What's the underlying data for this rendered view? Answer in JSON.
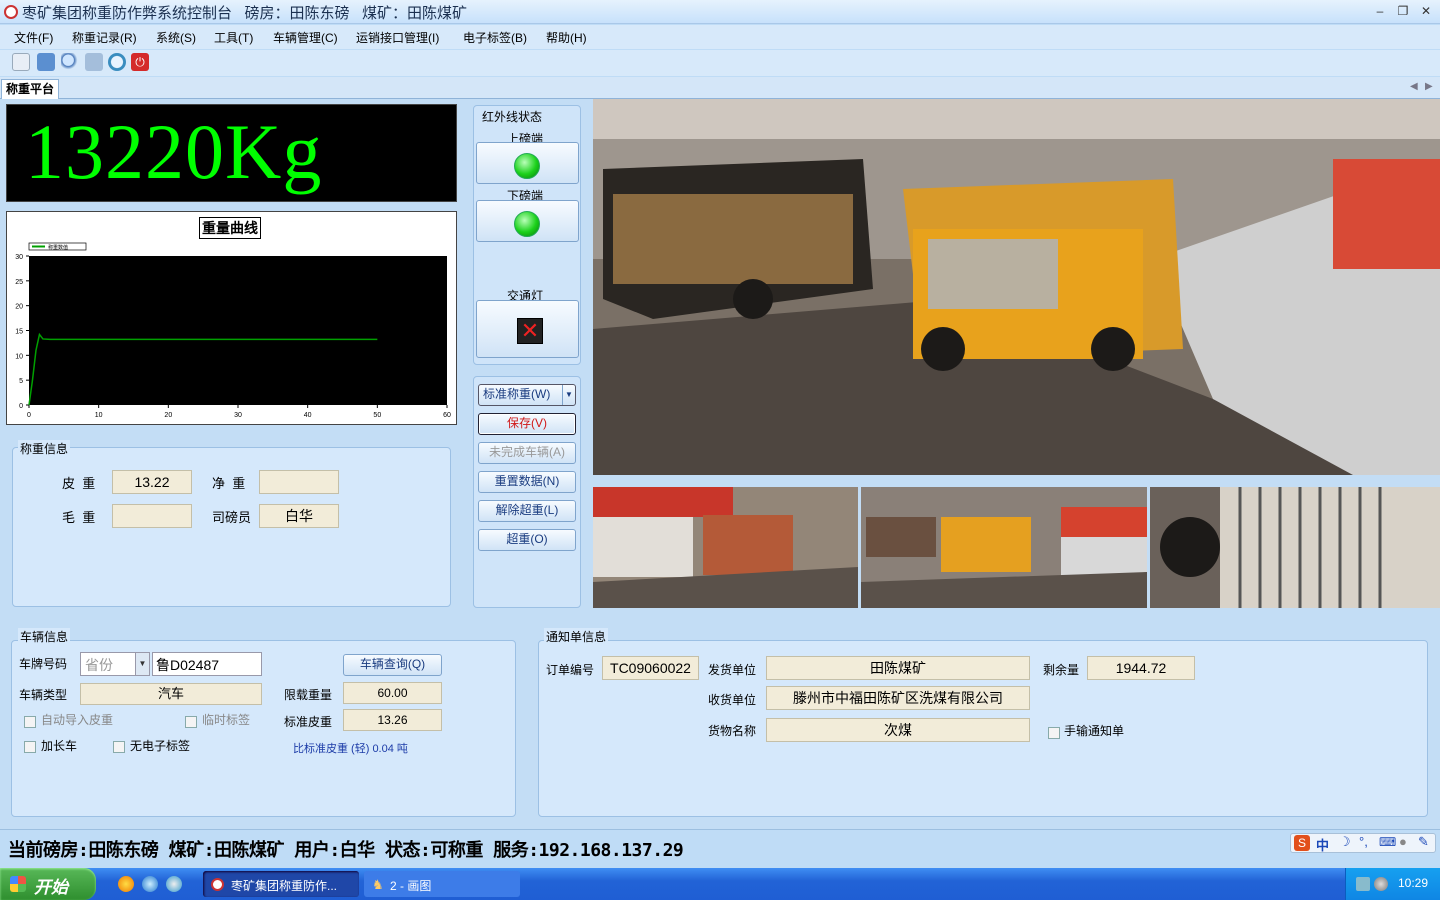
{
  "window": {
    "title": "枣矿集团称重防作弊系统控制台   磅房：田陈东磅   煤矿：田陈煤矿",
    "min": "–",
    "max": "❐",
    "close": "✕"
  },
  "menu": [
    "文件(F)",
    "称重记录(R)",
    "系统(S)",
    "工具(T)",
    "车辆管理(C)",
    "运销接口管理(I)",
    "电子标签(B)",
    "帮助(H)"
  ],
  "toolbar_icons": [
    "document-icon",
    "database-icon",
    "search-icon",
    "chart-icon",
    "clock-icon",
    "power-icon"
  ],
  "tab": {
    "label": "称重平台"
  },
  "weight_display": "13220Kg",
  "chart_data": {
    "type": "line",
    "title": "重量曲线",
    "legend": "称重数值",
    "x_ticks": [
      "0",
      "10",
      "20",
      "30",
      "40",
      "50",
      "60"
    ],
    "y_ticks": [
      "0",
      "5",
      "10",
      "15",
      "20",
      "25",
      "30"
    ],
    "xlim": [
      0,
      60
    ],
    "ylim": [
      0,
      30
    ],
    "series": [
      {
        "name": "称重数值",
        "color": "#00a000",
        "x": [
          0,
          0.5,
          1,
          1.5,
          2,
          3,
          50
        ],
        "y": [
          0,
          5,
          11,
          14.2,
          13.3,
          13.22,
          13.22
        ]
      }
    ]
  },
  "infrared": {
    "title": "红外线状态",
    "upper": "上磅端",
    "lower": "下磅端",
    "traffic": "交通灯",
    "upper_color": "#1bd11b",
    "lower_color": "#1bd11b",
    "traffic_color": "#cc2222"
  },
  "actions": {
    "mode": "标准称重(W)",
    "save": "保存(V)",
    "unfinished": "未完成车辆(A)",
    "reset": "重置数据(N)",
    "release": "解除超重(L)",
    "overweight": "超重(O)"
  },
  "weigh_info": {
    "title": "称重信息",
    "tare_label": "皮  重",
    "tare": "13.22",
    "net_label": "净  重",
    "net": "",
    "gross_label": "毛  重",
    "gross": "",
    "operator_label": "司磅员",
    "operator": "白华"
  },
  "vehicle": {
    "title": "车辆信息",
    "plate_label": "车牌号码",
    "province": "省份",
    "plate": "鲁D02487",
    "query": "车辆查询(Q)",
    "type_label": "车辆类型",
    "type": "汽车",
    "limit_label": "限载重量",
    "limit": "60.00",
    "std_tare_label": "标准皮重",
    "std_tare": "13.26",
    "auto_tare": "自动导入皮重",
    "temp_tag": "临时标签",
    "lengthened": "加长车",
    "no_tag": "无电子标签",
    "compare": "比标准皮重 (轻) 0.04 吨"
  },
  "notice": {
    "title": "通知单信息",
    "order_label": "订单编号",
    "order": "TC09060022",
    "sender_label": "发货单位",
    "sender": "田陈煤矿",
    "remain_label": "剩余量",
    "remain": "1944.72",
    "receiver_label": "收货单位",
    "receiver": "滕州市中福田陈矿区洗煤有限公司",
    "goods_label": "货物名称",
    "goods": "次煤",
    "manual": "手输通知单"
  },
  "status_line": "当前磅房:田陈东磅 煤矿:田陈煤矿 用户:白华 状态:可称重 服务:192.168.137.29",
  "ime": {
    "s": "S",
    "zh": "中"
  },
  "taskbar": {
    "start": "开始",
    "task1": "枣矿集团称重防作...",
    "task2": "2 - 画图",
    "clock": "10:29"
  },
  "colors": {
    "weight_text": "#00ff00",
    "accent": "#1f5ed4"
  }
}
